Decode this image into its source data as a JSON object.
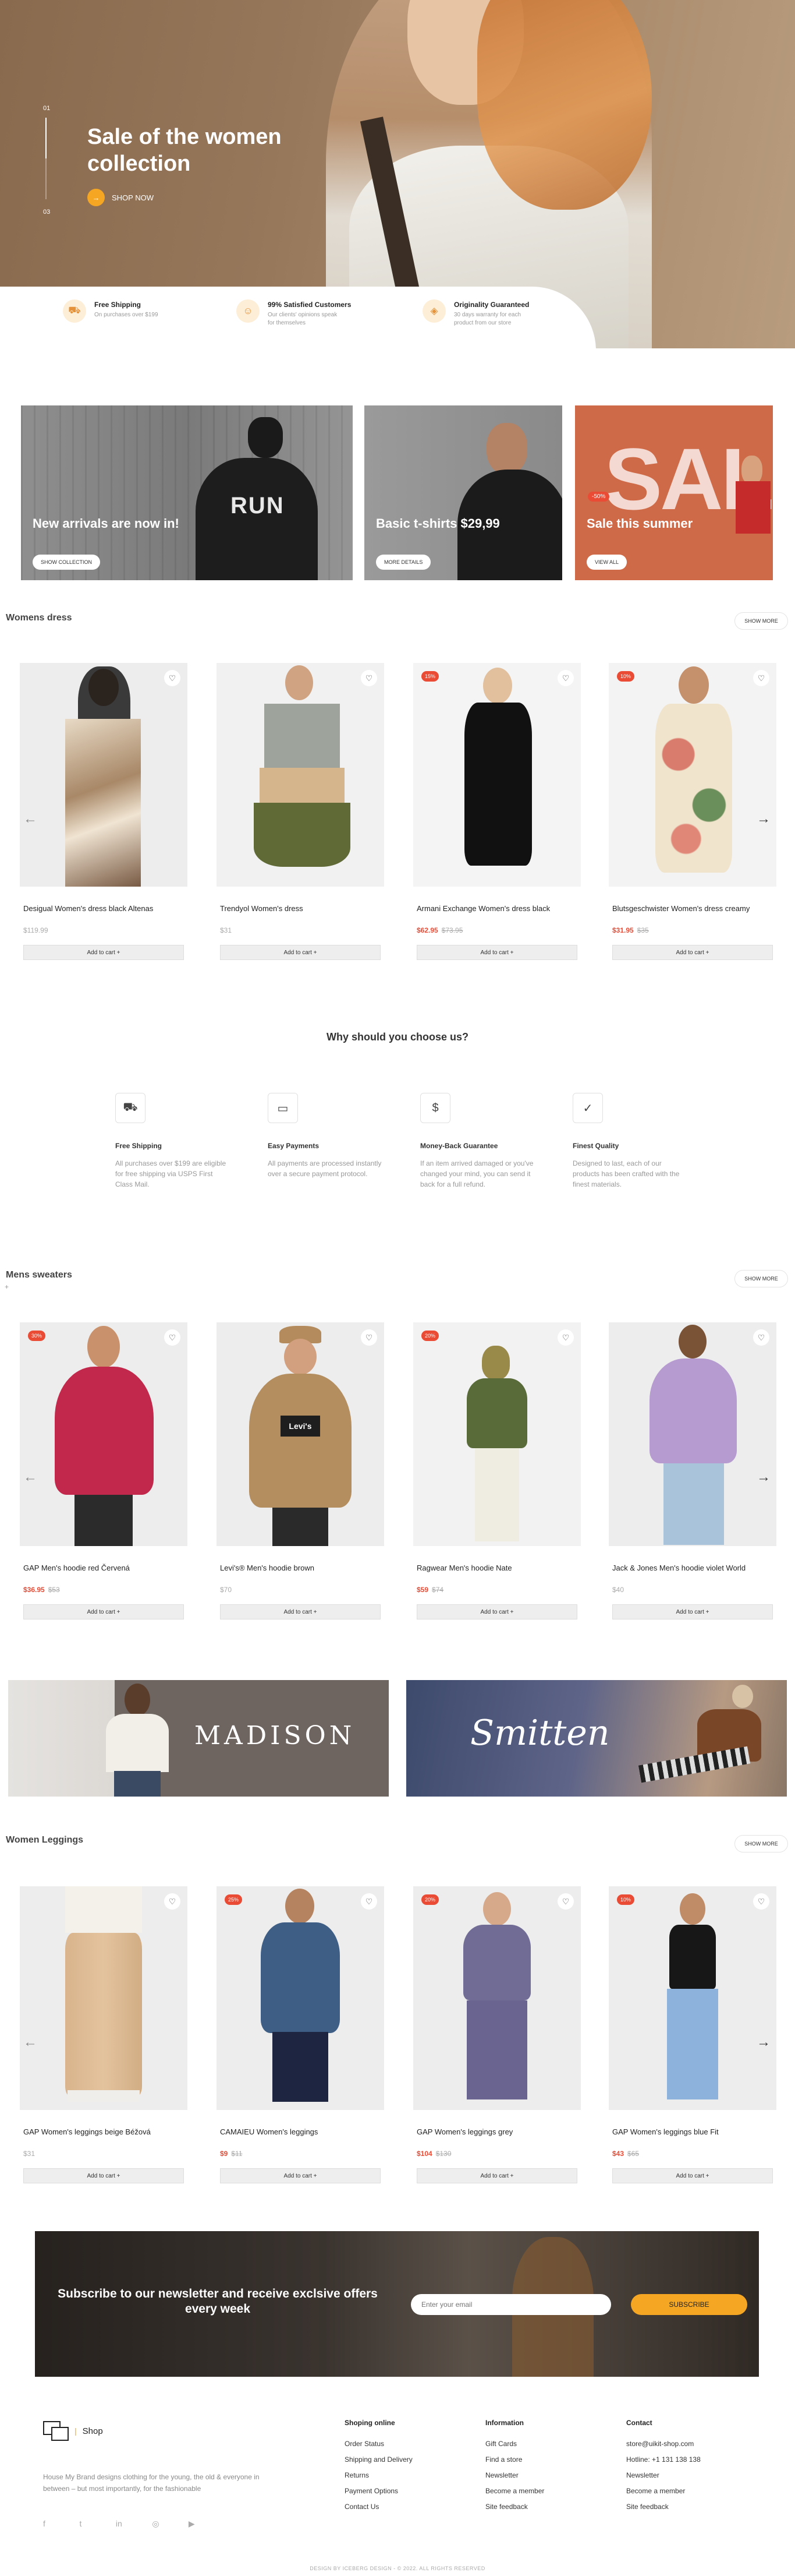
{
  "hero": {
    "slide_start": "01",
    "slide_end": "03",
    "title": "Sale of the women collection",
    "cta": "SHOP NOW"
  },
  "features": [
    {
      "title": "Free Shipping",
      "text": "On purchases over $199",
      "icon": "truck-icon"
    },
    {
      "title": "99% Satisfied Customers",
      "text": "Our clients' opinions speak for themselves",
      "icon": "smile-icon"
    },
    {
      "title": "Originality Guaranteed",
      "text": "30 days warranty for each product from our store",
      "icon": "shield-icon"
    }
  ],
  "promos": [
    {
      "caption": "New arrivals are now in!",
      "button": "SHOW COLLECTION",
      "shirt_text": "RUN"
    },
    {
      "caption": "Basic t-shirts $29,99",
      "button": "MORE DETAILS"
    },
    {
      "caption": "Sale this summer",
      "button": "VIEW ALL",
      "badge": "-50%",
      "bg_text": "SALE"
    }
  ],
  "show_more": "SHOW MORE",
  "add_to_cart": "Add to cart +",
  "sections": {
    "womens_dress": {
      "title": "Womens dress",
      "products": [
        {
          "name": "Desigual Women's dress black Altenas",
          "price": "$119.99",
          "old": "",
          "badge": ""
        },
        {
          "name": "Trendyol Women's dress",
          "price": "$31",
          "old": "",
          "badge": ""
        },
        {
          "name": "Armani Exchange Women's dress black",
          "price": "$62.95",
          "old": "$73.95",
          "badge": "15%"
        },
        {
          "name": "Blutsgeschwister Women's dress creamy",
          "price": "$31.95",
          "old": "$35",
          "badge": "10%"
        }
      ]
    },
    "mens_sweaters": {
      "title": "Mens sweaters",
      "products": [
        {
          "name": "GAP Men's hoodie red Červená",
          "price": "$36.95",
          "old": "$53",
          "badge": "30%"
        },
        {
          "name": "Levi's® Men's hoodie brown",
          "price": "$70",
          "old": "",
          "badge": "",
          "shirt_text": "Levi's"
        },
        {
          "name": "Ragwear Men's hoodie Nate",
          "price": "$59",
          "old": "$74",
          "badge": "20%"
        },
        {
          "name": "Jack & Jones Men's hoodie violet World",
          "price": "$40",
          "old": "",
          "badge": ""
        }
      ]
    },
    "women_leggings": {
      "title": "Women Leggings",
      "products": [
        {
          "name": "GAP Women's leggings beige Béžová",
          "price": "$31",
          "old": "",
          "badge": ""
        },
        {
          "name": "CAMAIEU Women's leggings",
          "price": "$9",
          "old": "$11",
          "badge": "25%"
        },
        {
          "name": "GAP Women's leggings grey",
          "price": "$104",
          "old": "$130",
          "badge": "20%"
        },
        {
          "name": "GAP Women's leggings blue Fit",
          "price": "$43",
          "old": "$65",
          "badge": "10%"
        }
      ]
    }
  },
  "why": {
    "title": "Why should you choose us?",
    "items": [
      {
        "title": "Free Shipping",
        "text": "All purchases over $199 are eligible for free shipping via USPS First Class Mail.",
        "icon": "truck-icon"
      },
      {
        "title": "Easy Payments",
        "text": "All payments are processed instantly over a secure payment protocol.",
        "icon": "card-icon"
      },
      {
        "title": "Money-Back Guarantee",
        "text": "If an item arrived damaged or you've changed your mind, you can send it back for a full refund.",
        "icon": "dollar-shield-icon"
      },
      {
        "title": "Finest Quality",
        "text": "Designed to last, each of our products has been crafted with the finest materials.",
        "icon": "quality-icon"
      }
    ]
  },
  "brands": [
    "MADISON",
    "Smitten"
  ],
  "newsletter": {
    "title": "Subscribe to our newsletter and receive exclsive offers every week",
    "placeholder": "Enter your email",
    "button": "SUBSCRIBE"
  },
  "footer": {
    "logo_text": "Shop",
    "about": "House My Brand designs clothing for the young, the old & everyone in between – but most importantly, for the fashionable",
    "columns": [
      {
        "title": "Shoping online",
        "links": [
          "Order Status",
          "Shipping and Delivery",
          "Returns",
          "Payment Options",
          "Contact Us"
        ]
      },
      {
        "title": "Information",
        "links": [
          "Gift Cards",
          "Find a store",
          "Newsletter",
          "Become a member",
          "Site feedback"
        ]
      },
      {
        "title": "Contact",
        "links": [
          "store@uikit-shop.com",
          "Hotline: +1 131 138 138",
          "Newsletter",
          "Become a member",
          "Site feedback"
        ]
      }
    ],
    "social": [
      "facebook-icon",
      "twitter-icon",
      "linkedin-icon",
      "instagram-icon",
      "youtube-icon"
    ],
    "copyright": "DESIGN BY ICEBERG DESIGN - © 2022. ALL RIGHTS RESERVED"
  },
  "colors": {
    "accent": "#f5a623",
    "sale": "#e94b35"
  }
}
